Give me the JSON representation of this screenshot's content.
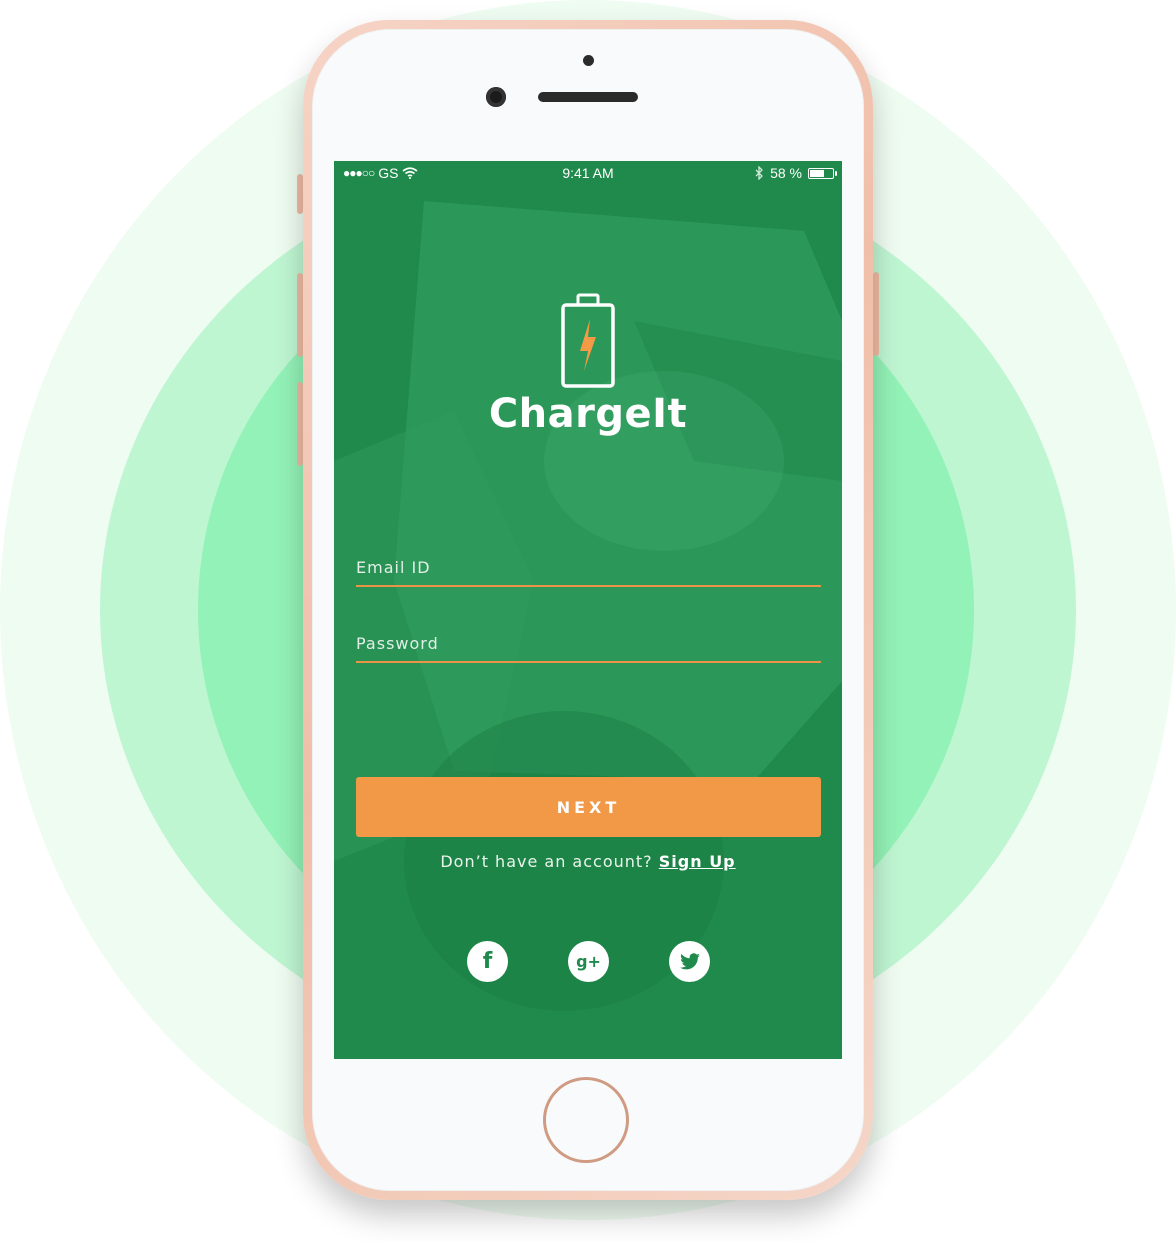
{
  "status_bar": {
    "signal": "●●●○○",
    "carrier": "GS",
    "time": "9:41 AM",
    "battery_percent": "58 %",
    "battery_level": 0.58
  },
  "app": {
    "name": "ChargeIt",
    "logo_icon": "battery-bolt-icon"
  },
  "form": {
    "email_placeholder": "Email ID",
    "password_placeholder": "Password",
    "next_label": "NEXT",
    "signup_prompt": "Don’t have an account?",
    "signup_link": "Sign Up"
  },
  "social": {
    "facebook_glyph": "f",
    "googleplus_glyph": "g+"
  },
  "colors": {
    "screen_green": "#208a4c",
    "accent_orange": "#f19947",
    "underline_orange": "#ec9446",
    "phone_rose_gold": "#f0bfa9",
    "ring_light": "#effcf1",
    "ring_mid": "#bff6d2",
    "ring_inner": "#93f2b7"
  }
}
